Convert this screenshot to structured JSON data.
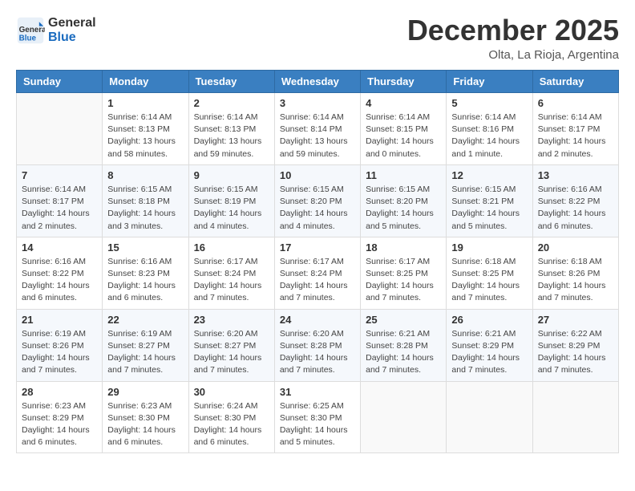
{
  "logo": {
    "general": "General",
    "blue": "Blue"
  },
  "title": "December 2025",
  "subtitle": "Olta, La Rioja, Argentina",
  "days_of_week": [
    "Sunday",
    "Monday",
    "Tuesday",
    "Wednesday",
    "Thursday",
    "Friday",
    "Saturday"
  ],
  "weeks": [
    [
      {
        "day": "",
        "info": ""
      },
      {
        "day": "1",
        "info": "Sunrise: 6:14 AM\nSunset: 8:13 PM\nDaylight: 13 hours\nand 58 minutes."
      },
      {
        "day": "2",
        "info": "Sunrise: 6:14 AM\nSunset: 8:13 PM\nDaylight: 13 hours\nand 59 minutes."
      },
      {
        "day": "3",
        "info": "Sunrise: 6:14 AM\nSunset: 8:14 PM\nDaylight: 13 hours\nand 59 minutes."
      },
      {
        "day": "4",
        "info": "Sunrise: 6:14 AM\nSunset: 8:15 PM\nDaylight: 14 hours\nand 0 minutes."
      },
      {
        "day": "5",
        "info": "Sunrise: 6:14 AM\nSunset: 8:16 PM\nDaylight: 14 hours\nand 1 minute."
      },
      {
        "day": "6",
        "info": "Sunrise: 6:14 AM\nSunset: 8:17 PM\nDaylight: 14 hours\nand 2 minutes."
      }
    ],
    [
      {
        "day": "7",
        "info": "Sunrise: 6:14 AM\nSunset: 8:17 PM\nDaylight: 14 hours\nand 2 minutes."
      },
      {
        "day": "8",
        "info": "Sunrise: 6:15 AM\nSunset: 8:18 PM\nDaylight: 14 hours\nand 3 minutes."
      },
      {
        "day": "9",
        "info": "Sunrise: 6:15 AM\nSunset: 8:19 PM\nDaylight: 14 hours\nand 4 minutes."
      },
      {
        "day": "10",
        "info": "Sunrise: 6:15 AM\nSunset: 8:20 PM\nDaylight: 14 hours\nand 4 minutes."
      },
      {
        "day": "11",
        "info": "Sunrise: 6:15 AM\nSunset: 8:20 PM\nDaylight: 14 hours\nand 5 minutes."
      },
      {
        "day": "12",
        "info": "Sunrise: 6:15 AM\nSunset: 8:21 PM\nDaylight: 14 hours\nand 5 minutes."
      },
      {
        "day": "13",
        "info": "Sunrise: 6:16 AM\nSunset: 8:22 PM\nDaylight: 14 hours\nand 6 minutes."
      }
    ],
    [
      {
        "day": "14",
        "info": "Sunrise: 6:16 AM\nSunset: 8:22 PM\nDaylight: 14 hours\nand 6 minutes."
      },
      {
        "day": "15",
        "info": "Sunrise: 6:16 AM\nSunset: 8:23 PM\nDaylight: 14 hours\nand 6 minutes."
      },
      {
        "day": "16",
        "info": "Sunrise: 6:17 AM\nSunset: 8:24 PM\nDaylight: 14 hours\nand 7 minutes."
      },
      {
        "day": "17",
        "info": "Sunrise: 6:17 AM\nSunset: 8:24 PM\nDaylight: 14 hours\nand 7 minutes."
      },
      {
        "day": "18",
        "info": "Sunrise: 6:17 AM\nSunset: 8:25 PM\nDaylight: 14 hours\nand 7 minutes."
      },
      {
        "day": "19",
        "info": "Sunrise: 6:18 AM\nSunset: 8:25 PM\nDaylight: 14 hours\nand 7 minutes."
      },
      {
        "day": "20",
        "info": "Sunrise: 6:18 AM\nSunset: 8:26 PM\nDaylight: 14 hours\nand 7 minutes."
      }
    ],
    [
      {
        "day": "21",
        "info": "Sunrise: 6:19 AM\nSunset: 8:26 PM\nDaylight: 14 hours\nand 7 minutes."
      },
      {
        "day": "22",
        "info": "Sunrise: 6:19 AM\nSunset: 8:27 PM\nDaylight: 14 hours\nand 7 minutes."
      },
      {
        "day": "23",
        "info": "Sunrise: 6:20 AM\nSunset: 8:27 PM\nDaylight: 14 hours\nand 7 minutes."
      },
      {
        "day": "24",
        "info": "Sunrise: 6:20 AM\nSunset: 8:28 PM\nDaylight: 14 hours\nand 7 minutes."
      },
      {
        "day": "25",
        "info": "Sunrise: 6:21 AM\nSunset: 8:28 PM\nDaylight: 14 hours\nand 7 minutes."
      },
      {
        "day": "26",
        "info": "Sunrise: 6:21 AM\nSunset: 8:29 PM\nDaylight: 14 hours\nand 7 minutes."
      },
      {
        "day": "27",
        "info": "Sunrise: 6:22 AM\nSunset: 8:29 PM\nDaylight: 14 hours\nand 7 minutes."
      }
    ],
    [
      {
        "day": "28",
        "info": "Sunrise: 6:23 AM\nSunset: 8:29 PM\nDaylight: 14 hours\nand 6 minutes."
      },
      {
        "day": "29",
        "info": "Sunrise: 6:23 AM\nSunset: 8:30 PM\nDaylight: 14 hours\nand 6 minutes."
      },
      {
        "day": "30",
        "info": "Sunrise: 6:24 AM\nSunset: 8:30 PM\nDaylight: 14 hours\nand 6 minutes."
      },
      {
        "day": "31",
        "info": "Sunrise: 6:25 AM\nSunset: 8:30 PM\nDaylight: 14 hours\nand 5 minutes."
      },
      {
        "day": "",
        "info": ""
      },
      {
        "day": "",
        "info": ""
      },
      {
        "day": "",
        "info": ""
      }
    ]
  ]
}
